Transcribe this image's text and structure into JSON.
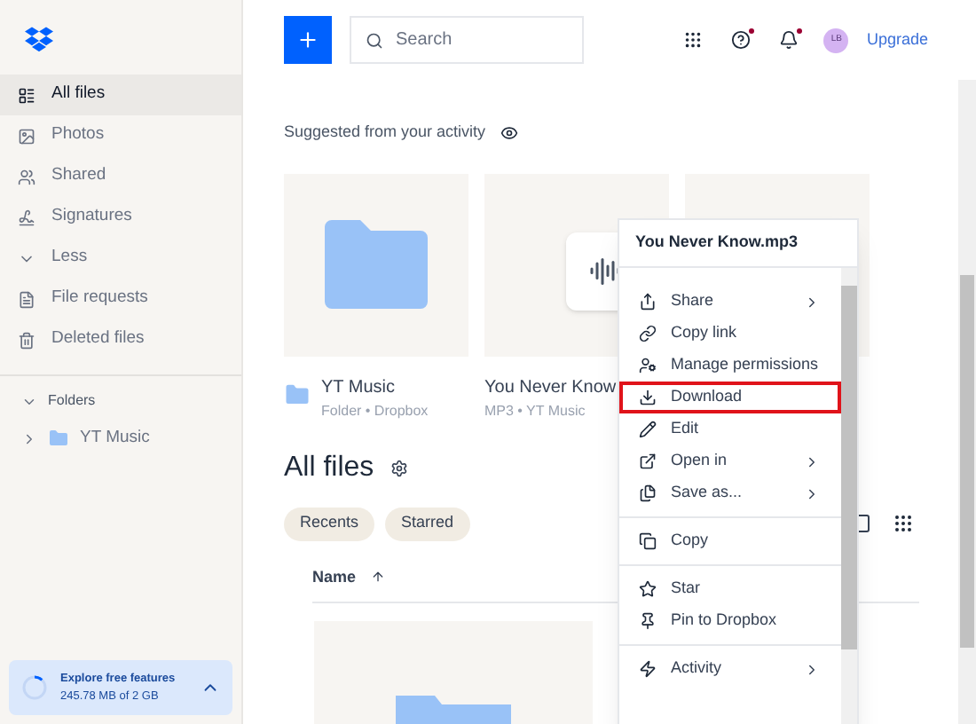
{
  "sidebar": {
    "items": [
      {
        "label": "All files",
        "selected": true
      },
      {
        "label": "Photos",
        "selected": false
      },
      {
        "label": "Shared",
        "selected": false
      },
      {
        "label": "Signatures",
        "selected": false
      },
      {
        "label": "Less",
        "selected": false
      },
      {
        "label": "File requests",
        "selected": false
      },
      {
        "label": "Deleted files",
        "selected": false
      }
    ],
    "folders": {
      "label": "Folders",
      "expanded": true,
      "children": [
        {
          "label": "YT Music",
          "expanded": false
        }
      ]
    },
    "storage": {
      "title": "Explore free features",
      "usage": "245.78 MB of 2 GB",
      "level": 0.12
    }
  },
  "topbar": {
    "search": {
      "placeholder": "Search"
    },
    "avatar": "LB",
    "upgrade": "Upgrade"
  },
  "suggested": {
    "title": "Suggested from your activity",
    "cards": [
      {
        "kind": "folder",
        "name": "YT Music",
        "meta": "Folder • Dropbox"
      },
      {
        "kind": "audio",
        "name": "You Never Know",
        "meta": "MP3 • YT Music"
      },
      {
        "kind": "blank"
      }
    ]
  },
  "files": {
    "title": "All files",
    "filters": [
      "Recents",
      "Starred"
    ],
    "column": "Name"
  },
  "context_menu": {
    "title": "You Never Know.mp3",
    "groups": [
      [
        {
          "label": "Share",
          "submenu": true,
          "highlighted": false
        },
        {
          "label": "Copy link",
          "submenu": false,
          "highlighted": false
        },
        {
          "label": "Manage permissions",
          "submenu": false,
          "highlighted": false
        },
        {
          "label": "Download",
          "submenu": false,
          "highlighted": true
        },
        {
          "label": "Edit",
          "submenu": false,
          "highlighted": false
        },
        {
          "label": "Open in",
          "submenu": true,
          "highlighted": false
        },
        {
          "label": "Save as...",
          "submenu": true,
          "highlighted": false
        }
      ],
      [
        {
          "label": "Copy",
          "submenu": false,
          "highlighted": false
        }
      ],
      [
        {
          "label": "Star",
          "submenu": false,
          "highlighted": false
        },
        {
          "label": "Pin to Dropbox",
          "submenu": false,
          "highlighted": false
        }
      ],
      [
        {
          "label": "Activity",
          "submenu": true,
          "highlighted": false
        }
      ]
    ]
  }
}
